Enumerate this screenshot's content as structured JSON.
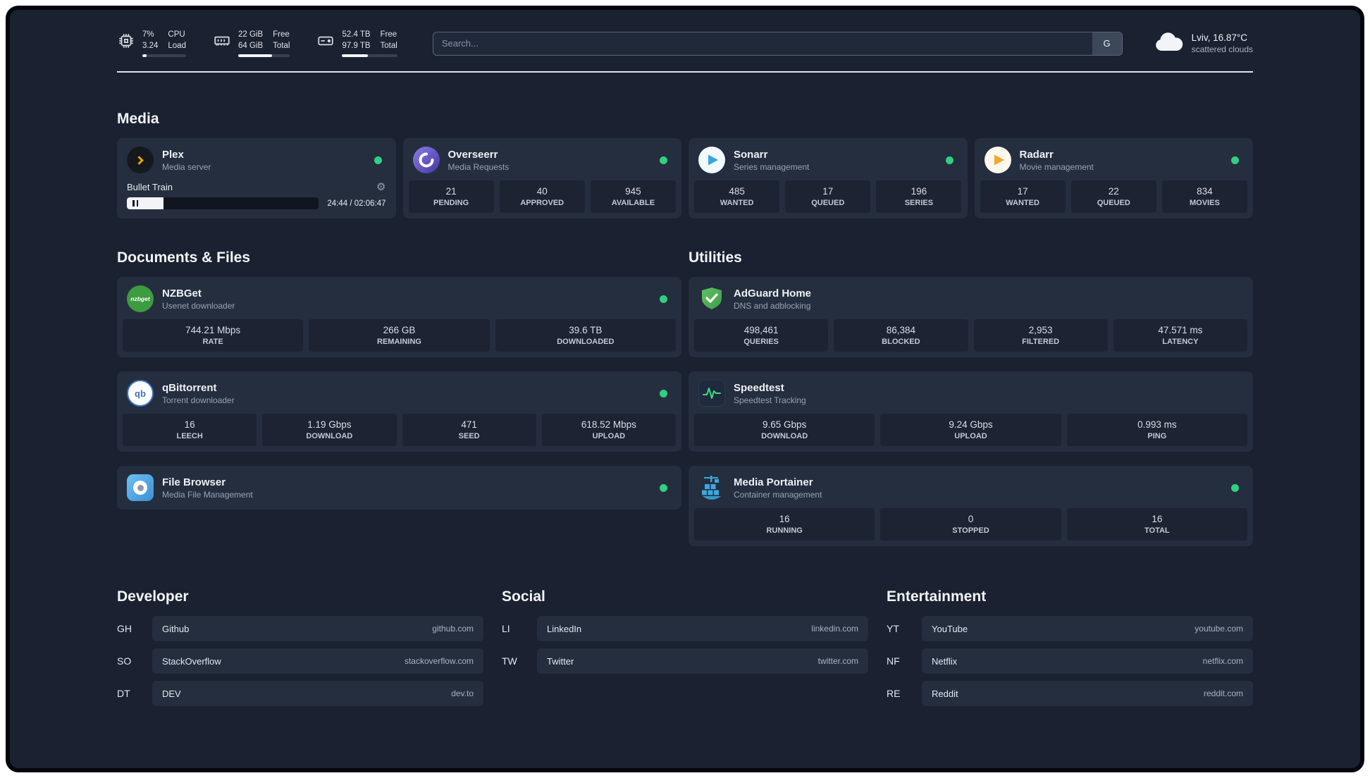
{
  "colors": {
    "status_online": "#2fd180",
    "plex_accent": "#e5a00d",
    "sonarr_accent": "#35a8e0",
    "radarr_accent": "#f0a732",
    "nzbget_green": "#3d9c3f",
    "qbittorrent_blue": "#3874c0",
    "adguard_green": "#53b456",
    "speedtest_green": "#3ddc84",
    "portainer_blue": "#3ba8e0"
  },
  "topbar": {
    "cpu": {
      "value_top": "7%",
      "value_bottom": "3.24",
      "label_top": "CPU",
      "label_bottom": "Load",
      "percent": 9
    },
    "ram": {
      "value_top": "22 GiB",
      "value_bottom": "64 GiB",
      "label_top": "Free",
      "label_bottom": "Total",
      "percent": 66
    },
    "disk": {
      "value_top": "52.4 TB",
      "value_bottom": "97.9 TB",
      "label_top": "Free",
      "label_bottom": "Total",
      "percent": 47
    },
    "search": {
      "placeholder": "Search...",
      "button_label": "G"
    },
    "weather": {
      "location": "Lviv, 16.87°C",
      "condition": "scattered clouds"
    }
  },
  "media": {
    "title": "Media",
    "cards": [
      {
        "name": "Plex",
        "subtitle": "Media server",
        "status": "online",
        "player": {
          "title": "Bullet Train",
          "time": "24:44 / 02:06:47",
          "progress_percent": 19
        }
      },
      {
        "name": "Overseerr",
        "subtitle": "Media Requests",
        "status": "online",
        "stats": [
          {
            "value": "21",
            "label": "PENDING"
          },
          {
            "value": "40",
            "label": "APPROVED"
          },
          {
            "value": "945",
            "label": "AVAILABLE"
          }
        ]
      },
      {
        "name": "Sonarr",
        "subtitle": "Series management",
        "status": "online",
        "stats": [
          {
            "value": "485",
            "label": "WANTED"
          },
          {
            "value": "17",
            "label": "QUEUED"
          },
          {
            "value": "196",
            "label": "SERIES"
          }
        ]
      },
      {
        "name": "Radarr",
        "subtitle": "Movie management",
        "status": "online",
        "stats": [
          {
            "value": "17",
            "label": "WANTED"
          },
          {
            "value": "22",
            "label": "QUEUED"
          },
          {
            "value": "834",
            "label": "MOVIES"
          }
        ]
      }
    ]
  },
  "documents": {
    "title": "Documents & Files",
    "cards": [
      {
        "name": "NZBGet",
        "subtitle": "Usenet downloader",
        "status": "online",
        "icon_text": "nzbget",
        "stats": [
          {
            "value": "744.21 Mbps",
            "label": "RATE"
          },
          {
            "value": "266 GB",
            "label": "REMAINING"
          },
          {
            "value": "39.6 TB",
            "label": "DOWNLOADED"
          }
        ]
      },
      {
        "name": "qBittorrent",
        "subtitle": "Torrent downloader",
        "status": "online",
        "icon_text": "qb",
        "stats": [
          {
            "value": "16",
            "label": "LEECH"
          },
          {
            "value": "1.19 Gbps",
            "label": "DOWNLOAD"
          },
          {
            "value": "471",
            "label": "SEED"
          },
          {
            "value": "618.52 Mbps",
            "label": "UPLOAD"
          }
        ]
      },
      {
        "name": "File Browser",
        "subtitle": "Media File Management",
        "status": "online",
        "stats": []
      }
    ]
  },
  "utilities": {
    "title": "Utilities",
    "cards": [
      {
        "name": "AdGuard Home",
        "subtitle": "DNS and adblocking",
        "stats": [
          {
            "value": "498,461",
            "label": "QUERIES"
          },
          {
            "value": "86,384",
            "label": "BLOCKED"
          },
          {
            "value": "2,953",
            "label": "FILTERED"
          },
          {
            "value": "47.571 ms",
            "label": "LATENCY"
          }
        ]
      },
      {
        "name": "Speedtest",
        "subtitle": "Speedtest Tracking",
        "stats": [
          {
            "value": "9.65 Gbps",
            "label": "DOWNLOAD"
          },
          {
            "value": "9.24 Gbps",
            "label": "UPLOAD"
          },
          {
            "value": "0.993 ms",
            "label": "PING"
          }
        ]
      },
      {
        "name": "Media Portainer",
        "subtitle": "Container management",
        "status": "online",
        "stats": [
          {
            "value": "16",
            "label": "RUNNING"
          },
          {
            "value": "0",
            "label": "STOPPED"
          },
          {
            "value": "16",
            "label": "TOTAL"
          }
        ]
      }
    ]
  },
  "bookmarks": {
    "developer": {
      "title": "Developer",
      "items": [
        {
          "abbr": "GH",
          "name": "Github",
          "domain": "github.com"
        },
        {
          "abbr": "SO",
          "name": "StackOverflow",
          "domain": "stackoverflow.com"
        },
        {
          "abbr": "DT",
          "name": "DEV",
          "domain": "dev.to"
        }
      ]
    },
    "social": {
      "title": "Social",
      "items": [
        {
          "abbr": "LI",
          "name": "LinkedIn",
          "domain": "linkedin.com"
        },
        {
          "abbr": "TW",
          "name": "Twitter",
          "domain": "twitter.com"
        }
      ]
    },
    "entertainment": {
      "title": "Entertainment",
      "items": [
        {
          "abbr": "YT",
          "name": "YouTube",
          "domain": "youtube.com"
        },
        {
          "abbr": "NF",
          "name": "Netflix",
          "domain": "netflix.com"
        },
        {
          "abbr": "RE",
          "name": "Reddit",
          "domain": "reddit.com"
        }
      ]
    }
  }
}
